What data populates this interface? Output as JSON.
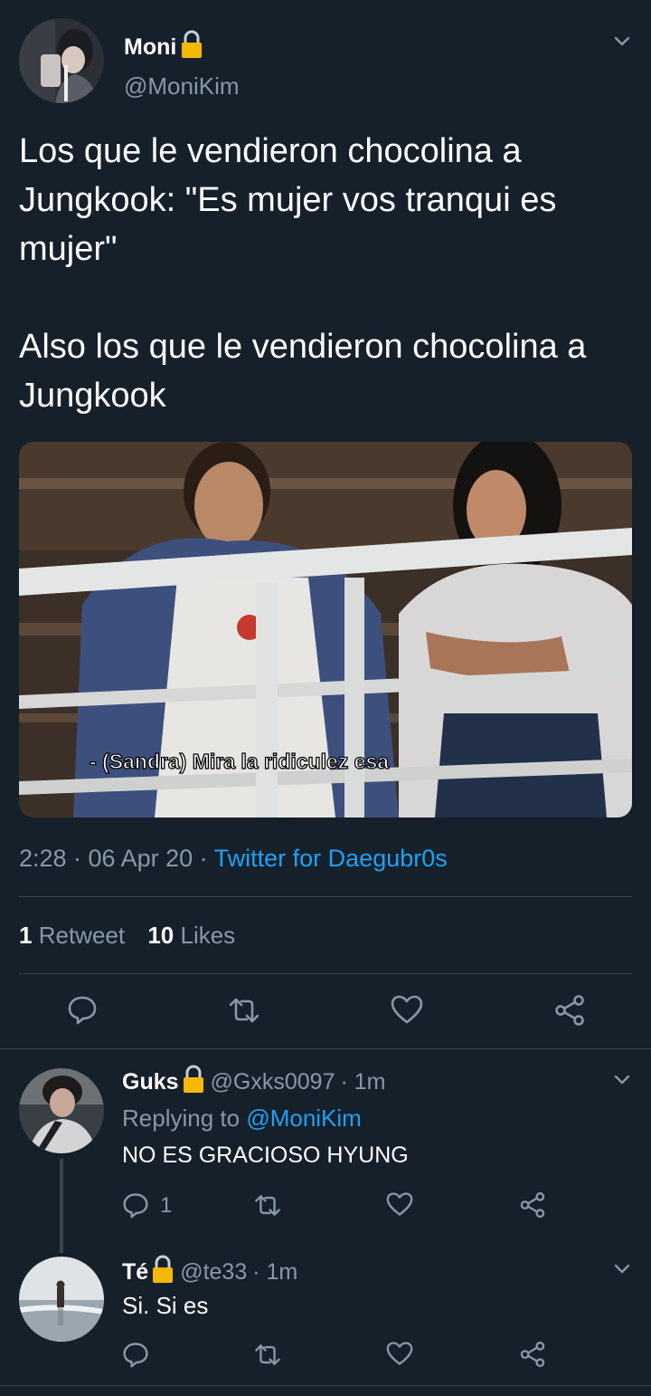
{
  "main_tweet": {
    "display_name": "Moni",
    "handle": "@MoniKim",
    "text_p1": "Los que le vendieron chocolina a Jungkook: \"Es mujer vos tranqui es mujer\"",
    "text_p2": "Also los que le vendieron chocolina a Jungkook",
    "image_caption": "- (Sandra) Mira la ridiculez esa",
    "time": "2:28 · 06 Apr 20 · ",
    "source": "Twitter for Daegubr0s",
    "retweet_count": "1",
    "retweet_label": "Retweet",
    "like_count": "10",
    "like_label": "Likes"
  },
  "replies": [
    {
      "display_name": "Guks",
      "handle": "@Gxks0097",
      "time": "· 1m",
      "replying_prefix": "Replying to ",
      "replying_to": "@MoniKim",
      "text": "NO ES GRACIOSO HYUNG",
      "reply_count": "1"
    },
    {
      "display_name": "Té",
      "handle": "@te33",
      "time": "· 1m",
      "text": "Si. Si es"
    }
  ],
  "icons": [
    "chevron-down-icon",
    "lock-icon",
    "reply-icon",
    "retweet-icon",
    "like-icon",
    "share-icon"
  ],
  "colors": {
    "background": "#15202b",
    "text": "#ffffff",
    "secondary": "#8899a6",
    "link": "#1da1f2",
    "divider": "#38444d",
    "lock": "#f5b800"
  }
}
